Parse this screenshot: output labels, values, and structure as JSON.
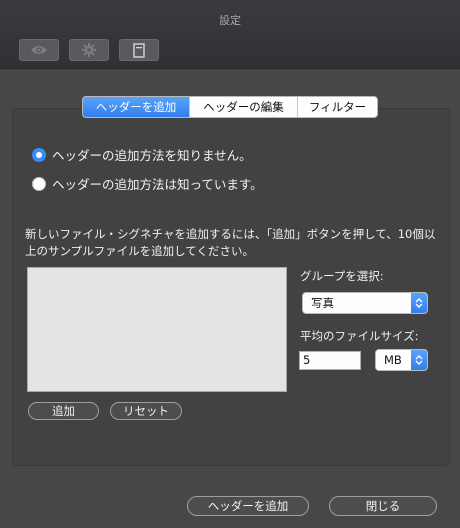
{
  "window": {
    "title": "設定"
  },
  "toolbar": {
    "buttons": [
      {
        "icon": "eye-icon"
      },
      {
        "icon": "gear-icon"
      },
      {
        "icon": "document-icon"
      }
    ]
  },
  "tabs": [
    {
      "label": "ヘッダーを追加",
      "active": true
    },
    {
      "label": "ヘッダーの編集",
      "active": false
    },
    {
      "label": "フィルター",
      "active": false
    }
  ],
  "options": [
    {
      "label": "ヘッダーの追加方法を知りません。",
      "selected": true
    },
    {
      "label": "ヘッダーの追加方法は知っています。",
      "selected": false
    }
  ],
  "description": "新しいファイル・シグネチャを追加するには、「追加」ボタンを押して、10個以上のサンプルファイルを追加してください。",
  "group": {
    "label": "グループを選択:",
    "value": "写真"
  },
  "file_size": {
    "label": "平均のファイルサイズ:",
    "value": "5",
    "unit": "MB"
  },
  "list_buttons": {
    "add": "追加",
    "reset": "リセット"
  },
  "footer": {
    "add_header": "ヘッダーを追加",
    "close": "閉じる"
  },
  "colors": {
    "accent": "#3a8cf7",
    "window_bg": "#474747",
    "titlebar_bg": "#333338"
  }
}
